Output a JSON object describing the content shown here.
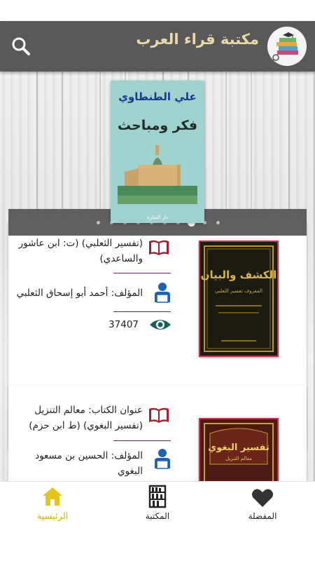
{
  "app": {
    "title": "مكتبة قراء العرب"
  },
  "banner": {
    "book_author": "علي الطنطاوي",
    "book_title": "فكر ومباحث",
    "book_publisher": "دار المنارة",
    "page_count": 10,
    "active_page": 7
  },
  "books": [
    {
      "title_partial": "تفسير الثعلبي) (ت: ابن عاشور والساعدي)",
      "title_first_line": "(تفسير الثعلبي) (ت: ابن عاشور",
      "title_second_line": "والساعدي)",
      "author": "المؤلف: أحمد أبو إسحاق الثعلبي",
      "views": "37407",
      "cover_title": "الكشف والبيان",
      "cover_sub": "المعروف تفسير الثعلبي"
    },
    {
      "title_first_line": "عنوان الكتاب: معالم التنزيل",
      "title_second_line": "(تفسير البغوي) (ط ابن حزم)",
      "author_first_line": "المؤلف: الحسين بن مسعود",
      "author_second_line": "البغوي",
      "cover_title": "تفسير البغوي",
      "cover_sub": "معالم التنزيل"
    }
  ],
  "nav": {
    "home": "الرئيسية",
    "library": "المكتبة",
    "favorites": "المفضلة"
  },
  "colors": {
    "appbar": "#595959",
    "title": "#e9d9a6",
    "active_nav": "#d4b300",
    "icon_red": "#a3202f",
    "icon_blue": "#1d63b3",
    "icon_teal": "#17615a"
  }
}
